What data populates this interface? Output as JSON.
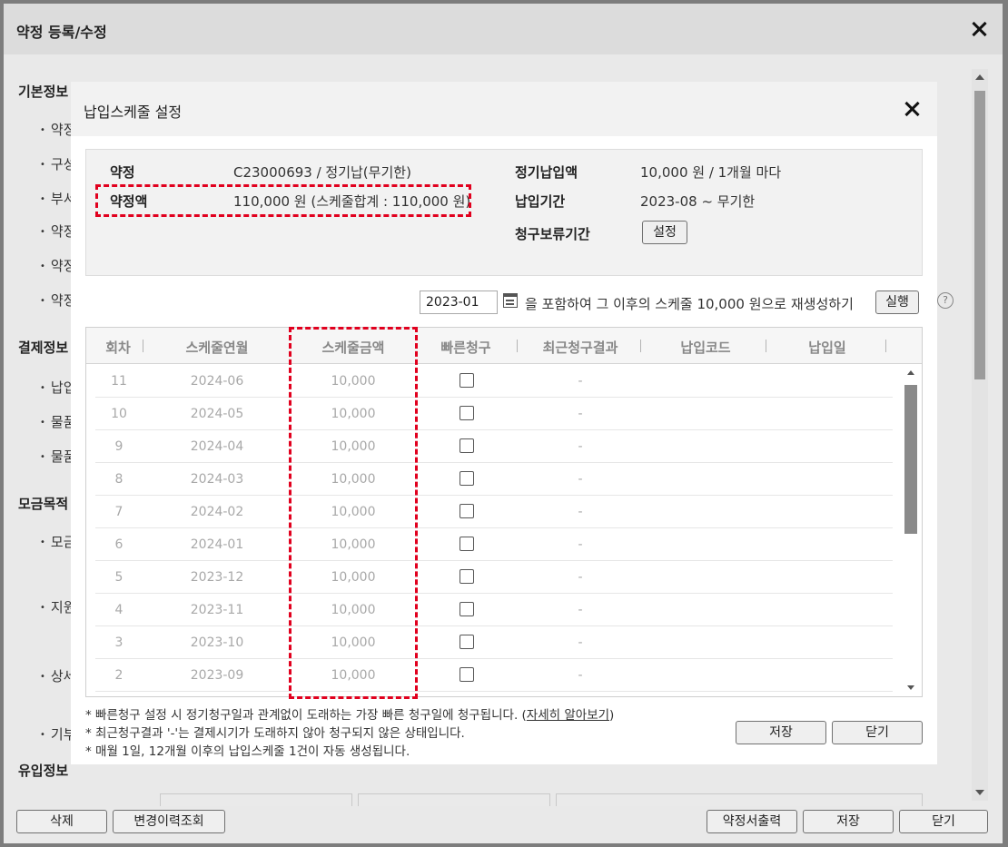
{
  "outer": {
    "title": "약정 등록/수정",
    "sections": [
      {
        "title": "기본정보",
        "items": [
          "약정",
          "구성",
          "부서",
          "약정",
          "약정",
          "약정"
        ]
      },
      {
        "title": "결제정보",
        "items": [
          "납입",
          "물품",
          "물품"
        ]
      },
      {
        "title": "모금목적",
        "items": [
          "모금",
          "지원",
          "상세",
          "기부"
        ]
      },
      {
        "title": "유입정보",
        "items": []
      }
    ],
    "buttons": {
      "delete": "삭제",
      "history": "변경이력조회",
      "print": "약정서출력",
      "save": "저장",
      "close": "닫기"
    }
  },
  "modal": {
    "title": "납입스케줄 설정",
    "info": {
      "pledge_label": "약정",
      "pledge_value": "C23000693 / 정기납(무기한)",
      "amount_label": "약정액",
      "amount_value": "110,000 원 (스케줄합계 : 110,000 원)",
      "regular_label": "정기납입액",
      "regular_value": "10,000 원 / 1개월 마다",
      "period_label": "납입기간",
      "period_value": "2023-08 ~ 무기한",
      "hold_label": "청구보류기간",
      "hold_button": "설정"
    },
    "regen": {
      "date": "2023-01",
      "text": "을 포함하여 그 이후의 스케줄 10,000 원으로 재생성하기",
      "button": "실행"
    },
    "grid": {
      "columns": [
        "회차",
        "스케줄연월",
        "스케줄금액",
        "빠른청구",
        "최근청구결과",
        "납입코드",
        "납입일"
      ],
      "rows": [
        {
          "no": "11",
          "ym": "2024-06",
          "amount": "10,000",
          "quick": false,
          "result": "-"
        },
        {
          "no": "10",
          "ym": "2024-05",
          "amount": "10,000",
          "quick": false,
          "result": "-"
        },
        {
          "no": "9",
          "ym": "2024-04",
          "amount": "10,000",
          "quick": false,
          "result": "-"
        },
        {
          "no": "8",
          "ym": "2024-03",
          "amount": "10,000",
          "quick": false,
          "result": "-"
        },
        {
          "no": "7",
          "ym": "2024-02",
          "amount": "10,000",
          "quick": false,
          "result": "-"
        },
        {
          "no": "6",
          "ym": "2024-01",
          "amount": "10,000",
          "quick": false,
          "result": "-"
        },
        {
          "no": "5",
          "ym": "2023-12",
          "amount": "10,000",
          "quick": false,
          "result": "-"
        },
        {
          "no": "4",
          "ym": "2023-11",
          "amount": "10,000",
          "quick": false,
          "result": "-"
        },
        {
          "no": "3",
          "ym": "2023-10",
          "amount": "10,000",
          "quick": false,
          "result": "-"
        },
        {
          "no": "2",
          "ym": "2023-09",
          "amount": "10,000",
          "quick": false,
          "result": "-"
        }
      ]
    },
    "notes": {
      "n1_prefix": "* 빠른청구 설정 시 정기청구일과 관계없이 도래하는 가장 빠른 청구일에 청구됩니다. (",
      "n1_link": "자세히 알아보기",
      "n1_suffix": ")",
      "n2": "* 최근청구결과 '-'는 결제시기가 도래하지 않아 청구되지 않은 상태입니다.",
      "n3": "* 매월 1일, 12개월 이후의 납입스케줄 1건이 자동 생성됩니다."
    },
    "buttons": {
      "save": "저장",
      "close": "닫기"
    }
  },
  "colors": {
    "highlight": "#e1001e",
    "modal_bg": "#ffffff",
    "header_bg": "#f2f2f2"
  }
}
